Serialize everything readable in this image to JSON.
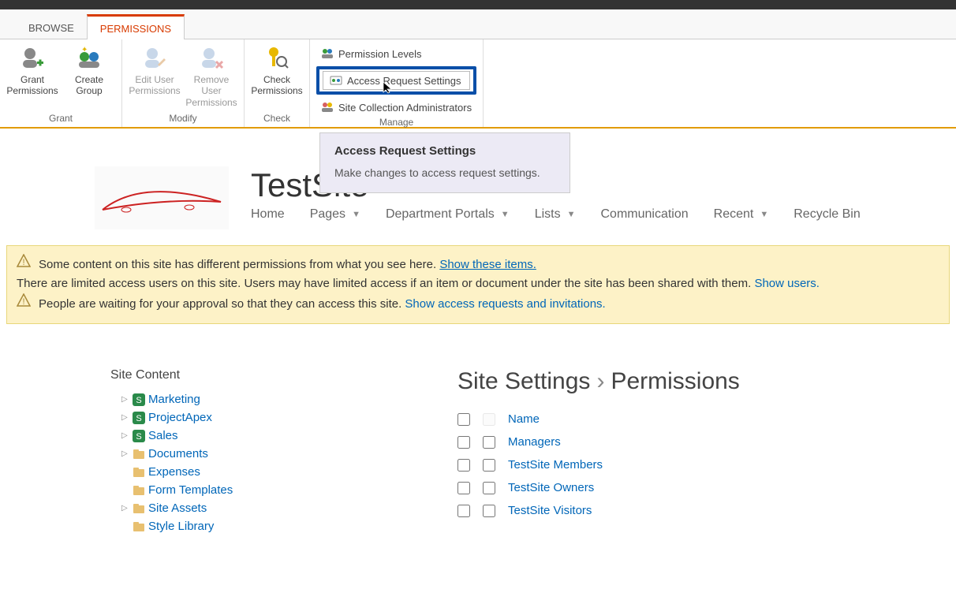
{
  "tabs": {
    "browse": "BROWSE",
    "permissions": "PERMISSIONS"
  },
  "ribbon": {
    "grant": {
      "label": "Grant",
      "grantPermissions": "Grant\nPermissions",
      "createGroup": "Create\nGroup"
    },
    "modify": {
      "label": "Modify",
      "editUser": "Edit User\nPermissions",
      "removeUser": "Remove User\nPermissions"
    },
    "check": {
      "label": "Check",
      "checkPermissions": "Check\nPermissions"
    },
    "manage": {
      "label": "Manage",
      "permissionLevels": "Permission Levels",
      "accessRequest": "Access Request Settings",
      "siteCollAdmin": "Site Collection Administrators"
    }
  },
  "tooltip": {
    "title": "Access Request Settings",
    "body": "Make changes to access request settings."
  },
  "site": {
    "title": "TestSite"
  },
  "nav": {
    "home": "Home",
    "pages": "Pages",
    "dept": "Department Portals",
    "lists": "Lists",
    "comm": "Communication",
    "recent": "Recent",
    "recycle": "Recycle Bin"
  },
  "warnings": {
    "line1a": "Some content on this site has different permissions from what you see here.",
    "line1link": "Show these items.",
    "line2a": "There are limited access users on this site. Users may have limited access if an item or document under the site has been shared with them.",
    "line2link": "Show users.",
    "line3a": "People are waiting for your approval so that they can access this site.",
    "line3link": "Show access requests and invitations."
  },
  "siteContent": {
    "heading": "Site Content",
    "items": [
      "Marketing",
      "ProjectApex",
      "Sales",
      "Documents",
      "Expenses",
      "Form Templates",
      "Site Assets",
      "Style Library"
    ]
  },
  "breadcrumb": {
    "a": "Site Settings",
    "b": "Permissions"
  },
  "permTable": {
    "header": "Name",
    "rows": [
      "Managers",
      "TestSite Members",
      "TestSite Owners",
      "TestSite Visitors"
    ]
  }
}
